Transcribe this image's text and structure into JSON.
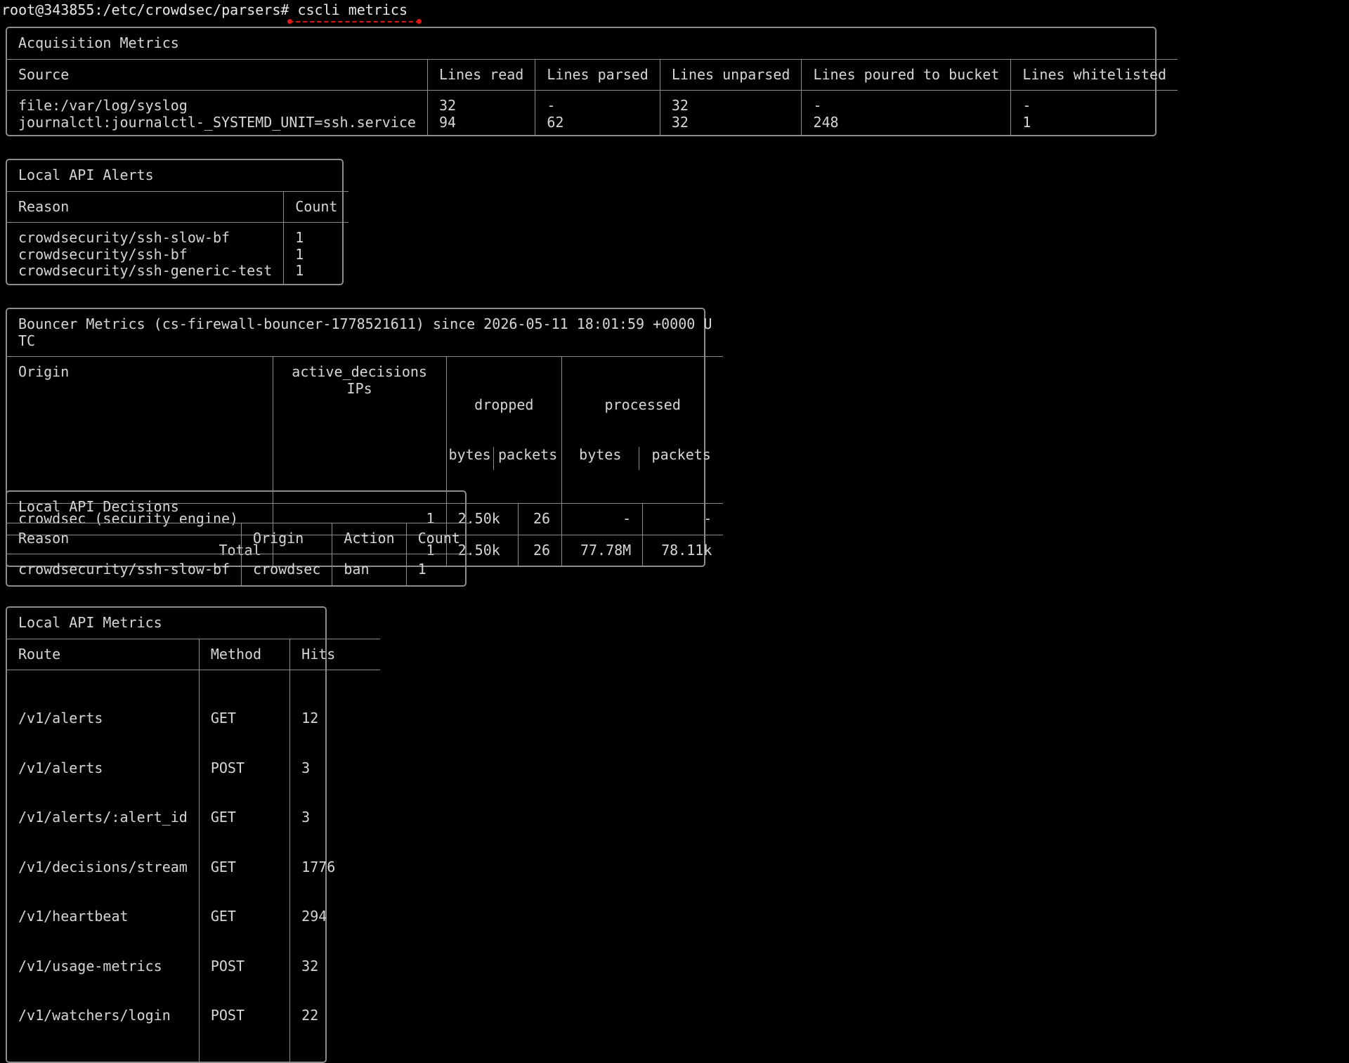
{
  "terminal": {
    "prompt": "root@343855:/etc/crowdsec/parsers#",
    "command": "cscli metrics"
  },
  "acquisition": {
    "title": "Acquisition Metrics",
    "headers": [
      "Source",
      "Lines read",
      "Lines parsed",
      "Lines unparsed",
      "Lines poured to bucket",
      "Lines whitelisted"
    ],
    "rows": [
      [
        "file:/var/log/syslog",
        "32",
        "-",
        "32",
        "-",
        "-"
      ],
      [
        "journalctl:journalctl-_SYSTEMD_UNIT=ssh.service",
        "94",
        "62",
        "32",
        "248",
        "1"
      ]
    ]
  },
  "alerts": {
    "title": "Local API Alerts",
    "headers": [
      "Reason",
      "Count"
    ],
    "rows": [
      [
        "crowdsecurity/ssh-slow-bf",
        "1"
      ],
      [
        "crowdsecurity/ssh-bf",
        "1"
      ],
      [
        "crowdsecurity/ssh-generic-test",
        "1"
      ]
    ]
  },
  "bouncer": {
    "title_line1": "Bouncer Metrics (cs-firewall-bouncer-1778521611) since 2026-05-11 18:01:59 +0000 U",
    "title_line2": "TC",
    "headers": {
      "origin": "Origin",
      "active_top": "active_decisions",
      "active_sub": "IPs",
      "dropped": "dropped",
      "processed": "processed",
      "bytes": "bytes",
      "packets": "packets"
    },
    "rows": [
      {
        "origin": "crowdsec (security engine)",
        "active": "1",
        "dropped_bytes": "2.50k",
        "dropped_packets": "26",
        "processed_bytes": "-",
        "processed_packets": "-"
      },
      {
        "origin": "Total",
        "active": "1",
        "dropped_bytes": "2.50k",
        "dropped_packets": "26",
        "processed_bytes": "77.78M",
        "processed_packets": "78.11k"
      }
    ]
  },
  "decisions": {
    "title": "Local API Decisions",
    "headers": [
      "Reason",
      "Origin",
      "Action",
      "Count"
    ],
    "rows": [
      [
        "crowdsecurity/ssh-slow-bf",
        "crowdsec",
        "ban",
        "1"
      ]
    ]
  },
  "lapi": {
    "title": "Local API Metrics",
    "headers": [
      "Route",
      "Method",
      "Hits"
    ],
    "rows": [
      [
        "/v1/alerts",
        "GET",
        "12"
      ],
      [
        "/v1/alerts",
        "POST",
        "3"
      ],
      [
        "/v1/alerts/:alert_id",
        "GET",
        "3"
      ],
      [
        "/v1/decisions/stream",
        "GET",
        "1776"
      ],
      [
        "/v1/heartbeat",
        "GET",
        "294"
      ],
      [
        "/v1/usage-metrics",
        "POST",
        "32"
      ],
      [
        "/v1/watchers/login",
        "POST",
        "22"
      ]
    ]
  },
  "colors": {
    "background": "#000000",
    "text": "#d6d6d6",
    "border": "#8c8c8c",
    "annotation": "#e01919"
  }
}
